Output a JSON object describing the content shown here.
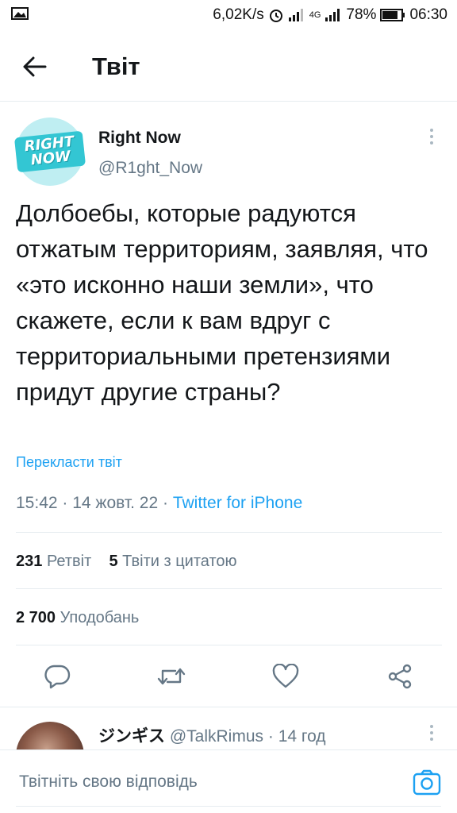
{
  "status_bar": {
    "speed": "6,02K/s",
    "network": "4G",
    "battery": "78%",
    "time": "06:30"
  },
  "header": {
    "title": "Твіт"
  },
  "tweet": {
    "avatar_text": "RIGHT NOW",
    "author_name": "Right Now",
    "author_handle": "@R1ght_Now",
    "text": "Долбоебы, которые радуются отжатым территориям, заявляя, что «это исконно наши земли», что скажете, если к вам вдруг с территориальными претензиями придут другие страны?",
    "translate_label": "Перекласти твіт",
    "time": "15:42",
    "date": "14 жовт. 22",
    "source": "Twitter for iPhone",
    "retweets_count": "231",
    "retweets_label": "Ретвіт",
    "quotes_count": "5",
    "quotes_label": "Твіти з цитатою",
    "likes_count": "2 700",
    "likes_label": "Уподобань"
  },
  "reply": {
    "name": "ジンギス",
    "handle": "@TalkRimus",
    "time": "14 год"
  },
  "composer": {
    "placeholder": "Твітніть свою відповідь"
  },
  "colors": {
    "accent": "#1da1f2",
    "secondary_text": "#657786",
    "primary_text": "#14171a",
    "divider": "#e6ecf0"
  }
}
